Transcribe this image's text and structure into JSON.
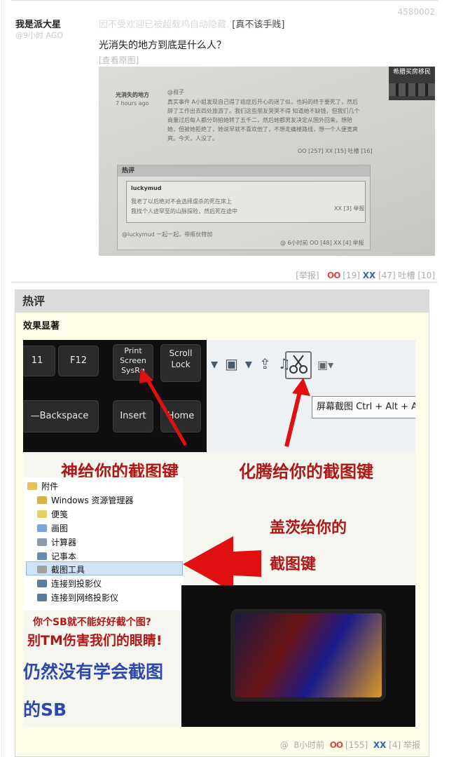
{
  "comment": {
    "author": "我是派大星",
    "time": "@9小时 AGO",
    "id": "4580002",
    "hidden_notice": "因不受欢迎已被超载鸡自动隐藏.",
    "show_link": "[真不该手贱]",
    "text": "光消失的地方到底是什么人？",
    "view_original": "[查看原图]",
    "photo": {
      "side_name": "光消失的地方",
      "side_time": "7 hours ago",
      "at_user": "@叔子",
      "body_lines": [
        "真实事件 A小姐发现自己得了癌症后开心的迷了似，也妈的终于要死了，然后",
        "辞了工作出去四处旅游了。我们这些朋友哭哭不得 知道她不缺钱，但我们几个",
        "商量过后每人都分到拍她转了五千二，然后她都男友决定从国外回来，想陪",
        "她，但被她拒绝了，她说早就不喜欢他了，不想走痛楼路线，想一个人便宽爽",
        "爽。今天，人没了。"
      ],
      "vote_line": "OO [257] XX [15] 吐槽 [16]",
      "hot_label": "热评",
      "reply_user": "luckymud",
      "reply_lines": [
        "我老了以后绝对不会选择虐杀的死在床上",
        "我找个人迹罕至的山脉探险，然后死在途中"
      ],
      "reply_votes": "XX [3] 举报",
      "footer": "@luckymud 一起一起，带瓶伙特加",
      "footer_votes": "@ 6小时前 OO [48] XX [4] 举报",
      "ad_text": "希腊买房移民"
    },
    "votes": {
      "report": "[举报]",
      "oo_label": "OO",
      "oo_count": "[19]",
      "xx_label": "XX",
      "xx_count": "[47]",
      "tucao": "吐槽 [10]"
    }
  },
  "hot_comment": {
    "header": "热评",
    "author": "效果显著",
    "meme": {
      "keys": [
        "11",
        "F12",
        "Print Screen SysRq",
        "Scroll Lock",
        "—Backspace",
        "Insert",
        "Home"
      ],
      "tooltip": "屏幕截图 Ctrl + Alt + A",
      "captions": {
        "god": "神给你的截图键",
        "tencent": "化腾给你的截图键",
        "gates_1": "盖茨给你的",
        "gates_2": "截图键",
        "sb_1": "你个SB就不能好好截个图?",
        "sb_2": "别TM伤害我们的眼睛!",
        "still_1": "仍然没有学会截图",
        "still_2": "的SB"
      },
      "menu_items": [
        "附件",
        "Windows 资源管理器",
        "便笺",
        "画图",
        "计算器",
        "记事本",
        "截图工具",
        "连接到投影仪",
        "连接到网络投影仪"
      ]
    },
    "votes": {
      "at": "@",
      "time": "8小时前",
      "oo_label": "OO",
      "oo_count": "[155]",
      "xx_label": "XX",
      "xx_count": "[4]",
      "report": "举报"
    }
  },
  "colors": {
    "oo": "#e04848",
    "xx": "#3a66a8",
    "hot_bg": "#fdfdea",
    "caption": "#b01818"
  }
}
